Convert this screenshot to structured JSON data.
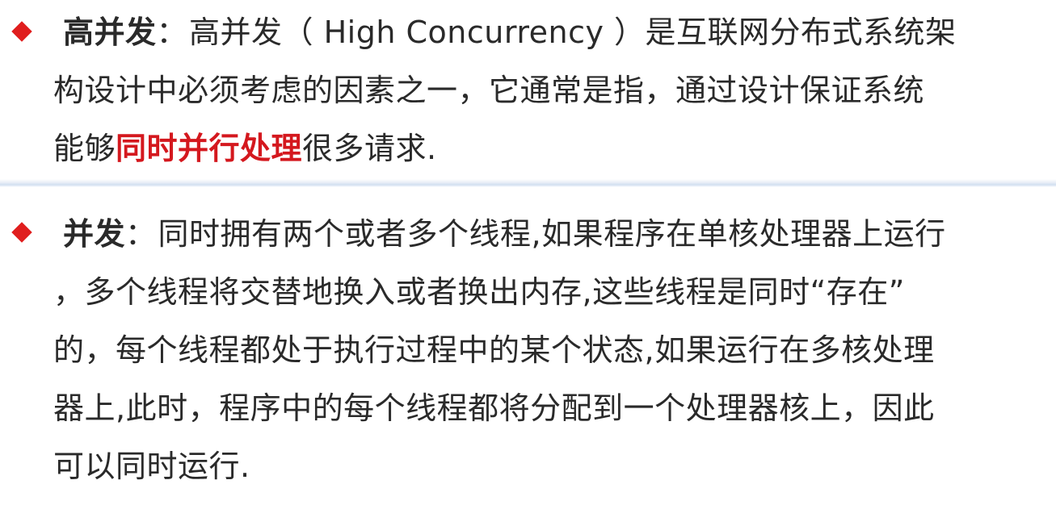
{
  "section1": {
    "bullet_icon": "red-diamond-icon",
    "term": "高并发",
    "colon": "：",
    "line1_rest": "高并发（ High Concurrency ）是互联网分布式系统架",
    "line2": "构设计中必须考虑的因素之一，它通常是指，通过设计保证系统",
    "line3_pre": "能够",
    "line3_highlight": "同时并行处理",
    "line3_post": "很多请求."
  },
  "section2": {
    "bullet_icon": "red-diamond-icon",
    "term": "并发",
    "colon": "：",
    "line1_rest": "同时拥有两个或者多个线程,如果程序在单核处理器上运行",
    "line2": "，多个线程将交替地换入或者换出内存,这些线程是同时“存在”",
    "line3": "的，每个线程都处于执行过程中的某个状态,如果运行在多核处理",
    "line4": "器上,此时，程序中的每个线程都将分配到一个处理器核上，因此",
    "line5": "可以同时运行."
  },
  "colors": {
    "bullet": "#e01e1e",
    "highlight": "#d4181e",
    "text": "#2a2a2a",
    "separator": "#d2dff0"
  }
}
